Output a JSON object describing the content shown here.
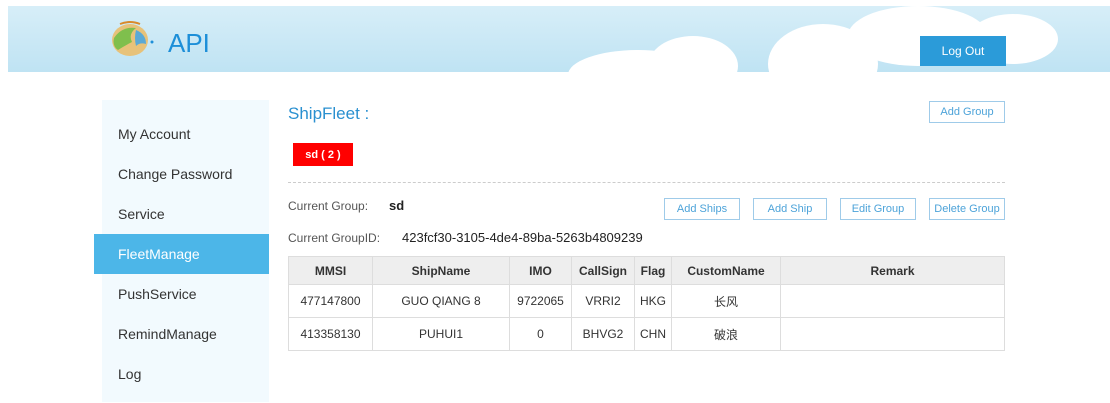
{
  "header": {
    "brand": "API",
    "logout_label": "Log Out"
  },
  "sidebar": {
    "items": [
      {
        "label": "My Account"
      },
      {
        "label": "Change Password"
      },
      {
        "label": "Service"
      },
      {
        "label": "FleetManage",
        "active": true
      },
      {
        "label": "PushService"
      },
      {
        "label": "RemindManage"
      },
      {
        "label": "Log"
      }
    ]
  },
  "main": {
    "title": "ShipFleet :",
    "add_group_label": "Add Group",
    "group_tag": "sd ( 2 )",
    "current_group_label": "Current Group:",
    "current_group_value": "sd",
    "current_groupid_label": "Current GroupID:",
    "current_groupid_value": "423fcf30-3105-4de4-89ba-5263b4809239",
    "actions": {
      "add_ships": "Add Ships",
      "add_ship": "Add Ship",
      "edit_group": "Edit Group",
      "delete_group": "Delete Group"
    },
    "table": {
      "headers": [
        "MMSI",
        "ShipName",
        "IMO",
        "CallSign",
        "Flag",
        "CustomName",
        "Remark"
      ],
      "rows": [
        [
          "477147800",
          "GUO QIANG 8",
          "9722065",
          "VRRI2",
          "HKG",
          "长风",
          ""
        ],
        [
          "413358130",
          "PUHUI1",
          "0",
          "BHVG2",
          "CHN",
          "破浪",
          ""
        ]
      ]
    }
  },
  "colors": {
    "accent": "#2b9bd9",
    "active_nav": "#4cb6e8",
    "group_tag": "#ff0000",
    "title": "#2a90d0"
  }
}
